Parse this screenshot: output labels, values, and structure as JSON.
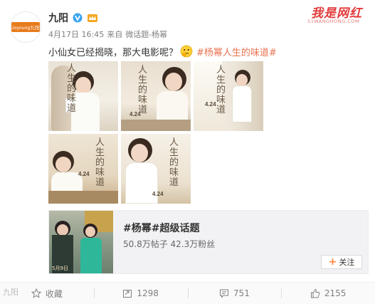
{
  "post": {
    "username": "九阳",
    "avatar_logo": "Joyoung九阳",
    "time": "4月17日 16:45",
    "source_prefix": "来自",
    "source": "微话题-杨幂",
    "text": "小仙女已经揭晓，那大电影呢？",
    "hashtag": "#杨幂人生的味道#",
    "icons": {
      "verify": "verified-v-icon",
      "vip": "vip-crown-icon",
      "emoji": "thinking-emoji-icon"
    }
  },
  "watermark": {
    "title": "我是网红",
    "subtitle": "51WANGHONG.COM"
  },
  "photos": [
    {
      "title": "人生的味道",
      "date": ""
    },
    {
      "title": "人生的味道",
      "date": "4.24"
    },
    {
      "title": "人生的味道",
      "date": "4.24"
    },
    {
      "title": "人生的味道",
      "date": "4.24"
    },
    {
      "title": "人生的味道",
      "date": "4.24"
    }
  ],
  "topic": {
    "title": "#杨幂#超级话题",
    "stats": "50.8万帖子 42.3万粉丝",
    "follow_label": "关注",
    "image_caption": "5月9日"
  },
  "actions": {
    "favorite": "收藏",
    "repost": "1298",
    "comment": "751",
    "like": "2155"
  },
  "bottom_watermark": "九阳"
}
